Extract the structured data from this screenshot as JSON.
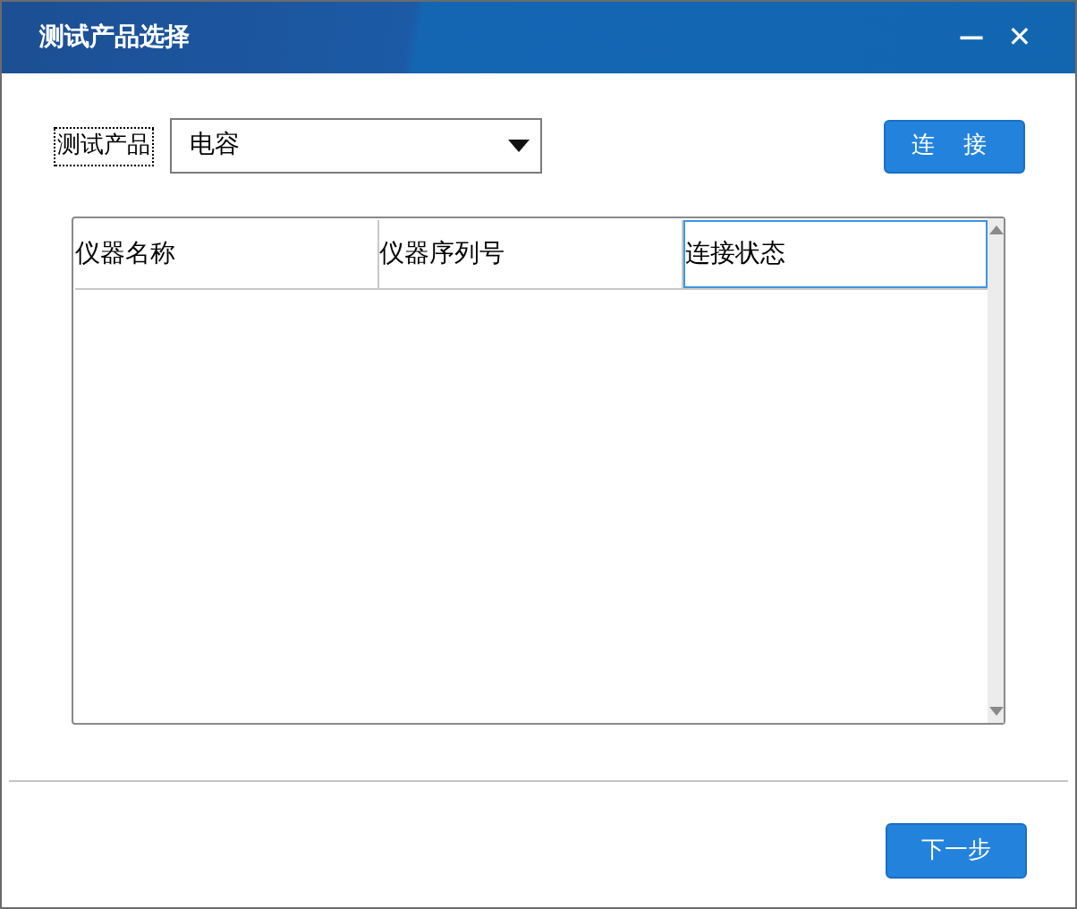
{
  "window": {
    "title": "测试产品选择",
    "controls": [
      "—",
      "✕"
    ]
  },
  "product": {
    "label": "测试产品",
    "value": "电容"
  },
  "connect_button": "连 接",
  "table": {
    "columns": [
      {
        "label": "仪器名称",
        "focused": false
      },
      {
        "label": "仪器序列号",
        "focused": false
      },
      {
        "label": "连接状态",
        "focused": true
      }
    ]
  },
  "next_button": "下一步"
}
